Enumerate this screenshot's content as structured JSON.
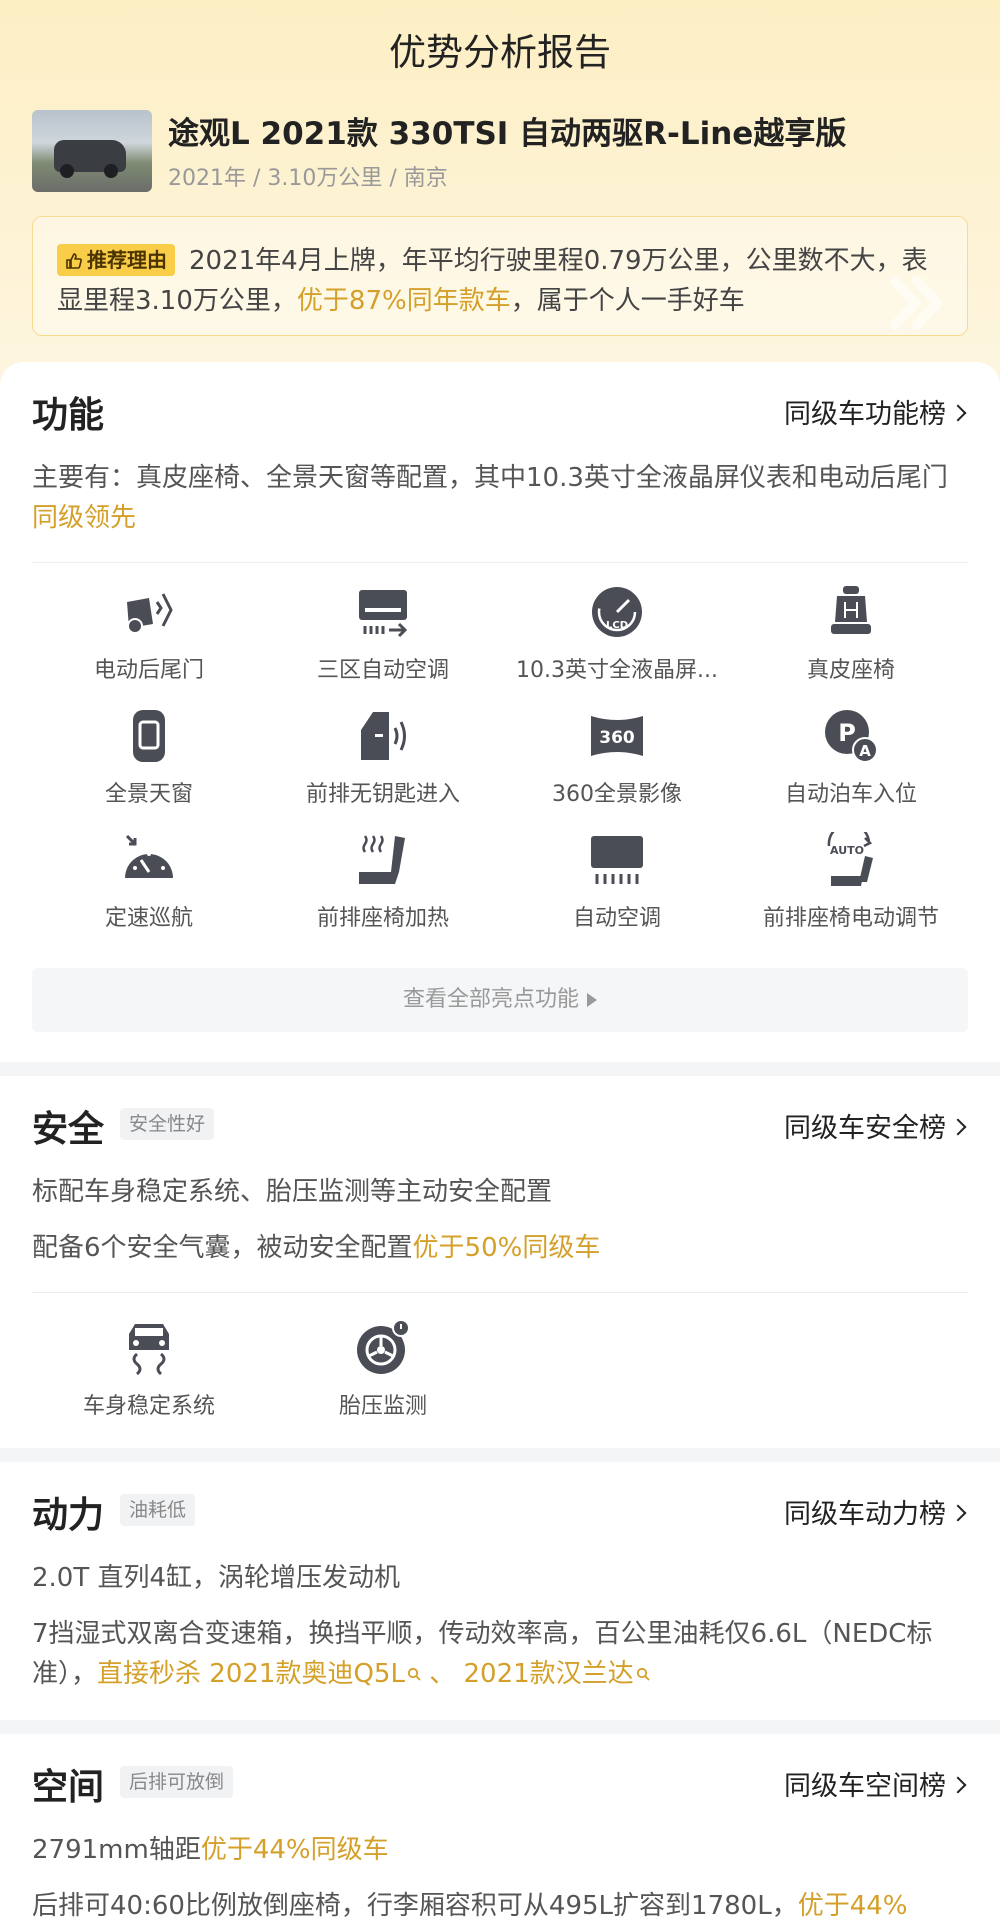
{
  "page": {
    "title": "优势分析报告"
  },
  "car": {
    "name": "途观L 2021款 330TSI 自动两驱R-Line越享版",
    "meta": "2021年 / 3.10万公里 / 南京"
  },
  "recommend": {
    "tag": "推荐理由",
    "text_before": "2021年4月上牌，年平均行驶里程0.79万公里，公里数不大，表显里程3.10万公里，",
    "highlight": "优于87%同年款车",
    "text_after": "，属于个人一手好车"
  },
  "function": {
    "title": "功能",
    "link": "同级车功能榜",
    "desc_before": "主要有：真皮座椅、全景天窗等配置，其中10.3英寸全液晶屏仪表和电动后尾门",
    "desc_highlight": "同级领先",
    "features": [
      {
        "label": "电动后尾门",
        "icon": "tailgate-icon"
      },
      {
        "label": "三区自动空调",
        "icon": "tri-zone-ac-icon"
      },
      {
        "label": "10.3英寸全液晶屏...",
        "icon": "lcd-dashboard-icon"
      },
      {
        "label": "真皮座椅",
        "icon": "leather-seat-icon"
      },
      {
        "label": "全景天窗",
        "icon": "panoramic-sunroof-icon"
      },
      {
        "label": "前排无钥匙进入",
        "icon": "keyless-entry-icon"
      },
      {
        "label": "360全景影像",
        "icon": "camera-360-icon"
      },
      {
        "label": "自动泊车入位",
        "icon": "auto-parking-icon"
      },
      {
        "label": "定速巡航",
        "icon": "cruise-control-icon"
      },
      {
        "label": "前排座椅加热",
        "icon": "seat-heating-icon"
      },
      {
        "label": "自动空调",
        "icon": "auto-ac-icon"
      },
      {
        "label": "前排座椅电动调节",
        "icon": "power-seat-icon"
      }
    ],
    "view_all": "查看全部亮点功能"
  },
  "safety": {
    "title": "安全",
    "badge": "安全性好",
    "link": "同级车安全榜",
    "line1": "标配车身稳定系统、胎压监测等主动安全配置",
    "line2_before": "配备6个安全气囊，被动安全配置",
    "line2_highlight": "优于50%同级车",
    "features": [
      {
        "label": "车身稳定系统",
        "icon": "stability-control-icon"
      },
      {
        "label": "胎压监测",
        "icon": "tire-pressure-icon"
      }
    ]
  },
  "power": {
    "title": "动力",
    "badge": "油耗低",
    "link": "同级车动力榜",
    "line1": "2.0T 直列4缸，涡轮增压发动机",
    "line2": "7挡湿式双离合变速箱，换挡平顺，传动效率高，百公里油耗仅6.6L（NEDC标准），",
    "hl_prefix": "直接秒杀",
    "rival1": "2021款奥迪Q5L",
    "separator": "、",
    "rival2": "2021款汉兰达"
  },
  "space": {
    "title": "空间",
    "badge": "后排可放倒",
    "link": "同级车空间榜",
    "line1_before": "2791mm轴距",
    "line1_highlight": "优于44%同级车",
    "line2_before": "后排可40:60比例放倒座椅，行李厢容积可从495L扩容到1780L，",
    "line2_highlight": "优于44%"
  },
  "colors": {
    "accent": "#d4a02a",
    "tag_bg": "#f9cd48",
    "icon": "#4a4d55"
  }
}
